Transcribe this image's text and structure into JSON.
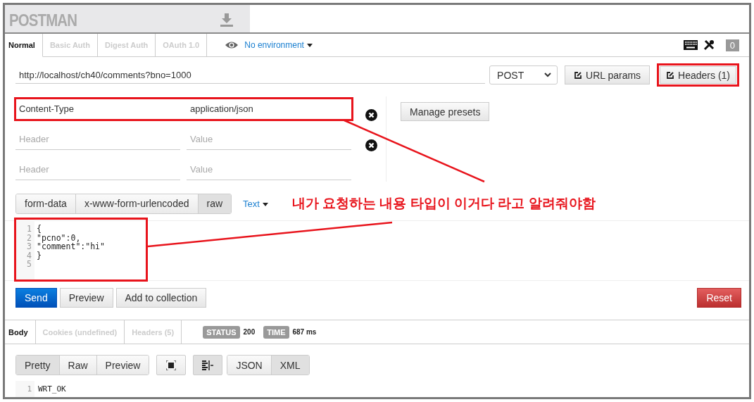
{
  "app": {
    "logo": "POSTMAN"
  },
  "auth_tabs": [
    {
      "label": "Normal",
      "selected": true
    },
    {
      "label": "Basic Auth",
      "selected": false
    },
    {
      "label": "Digest Auth",
      "selected": false
    },
    {
      "label": "OAuth 1.0",
      "selected": false
    }
  ],
  "environment": "No environment",
  "badge": "0",
  "url": "http://localhost/ch40/comments?bno=1000",
  "method": "POST",
  "url_params_button": {
    "label": "URL params",
    "highlighted": false
  },
  "headers_button": {
    "label": "Headers (1)",
    "highlighted": true
  },
  "headers": [
    {
      "key": "Content-Type",
      "value": "application/json",
      "highlighted": true,
      "removable": true
    },
    {
      "key_placeholder": "Header",
      "value_placeholder": "Value",
      "highlighted": false,
      "removable": true
    },
    {
      "key_placeholder": "Header",
      "value_placeholder": "Value",
      "highlighted": false,
      "removable": false
    }
  ],
  "manage_presets": "Manage presets",
  "body_modes": [
    {
      "label": "form-data",
      "selected": false
    },
    {
      "label": "x-www-form-urlencoded",
      "selected": false
    },
    {
      "label": "raw",
      "selected": true
    }
  ],
  "body_format": "Text",
  "annotation": "내가 요청하는 내용 타입이 이거다 라고 알려줘야함",
  "editor": {
    "highlighted": true,
    "lines": [
      {
        "number": "1",
        "code": "{"
      },
      {
        "number": "2",
        "code": "\"pcno\":0,"
      },
      {
        "number": "3",
        "code": "\"comment\":\"hi\""
      },
      {
        "number": "4",
        "code": "}"
      },
      {
        "number": "5"
      }
    ]
  },
  "actions": [
    {
      "label": "Send",
      "kind": "primary"
    },
    {
      "label": "Preview",
      "kind": "default"
    },
    {
      "label": "Add to collection",
      "kind": "default"
    },
    {
      "label": "Reset",
      "kind": "danger"
    }
  ],
  "response_tabs": [
    {
      "label": "Body",
      "selected": true
    },
    {
      "label": "Cookies (undefined)",
      "selected": false
    },
    {
      "label": "Headers (5)",
      "selected": false
    }
  ],
  "status": {
    "label": "STATUS",
    "value": "200"
  },
  "time": {
    "label": "TIME",
    "value": "687 ms"
  },
  "view_modes": [
    {
      "label": "Pretty",
      "selected": true
    },
    {
      "label": "Raw",
      "selected": false
    },
    {
      "label": "Preview",
      "selected": false
    }
  ],
  "icon_buttons": [
    {
      "kind": "fullscreen",
      "selected": false
    },
    {
      "kind": "wrap",
      "selected": true
    }
  ],
  "formats": [
    {
      "label": "JSON",
      "selected": false
    },
    {
      "label": "XML",
      "selected": true
    }
  ],
  "response_lines": [
    {
      "number": "1",
      "code": "WRT_OK"
    }
  ]
}
